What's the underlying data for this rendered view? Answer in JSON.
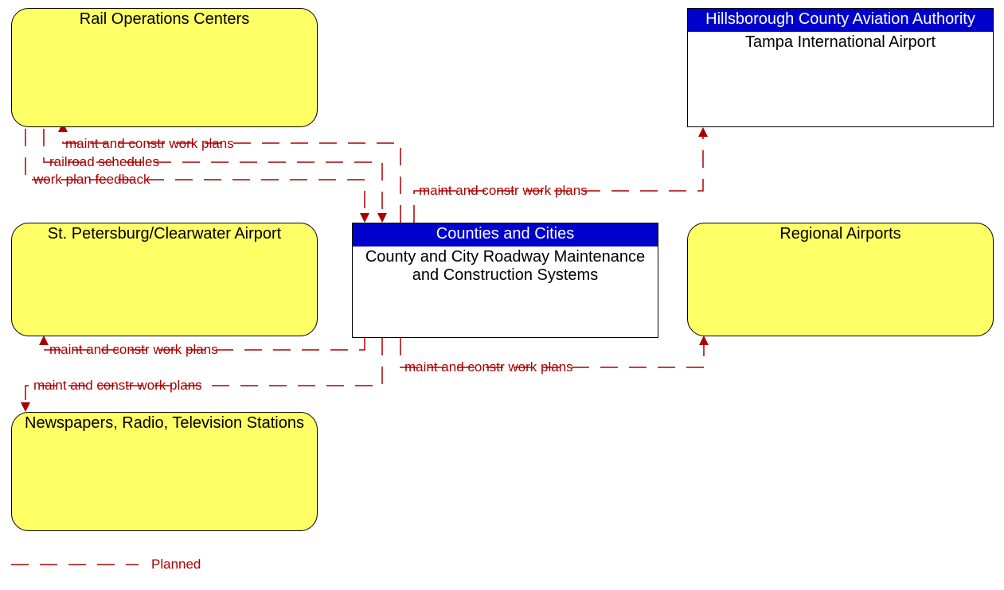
{
  "chart_data": {
    "type": "diagram",
    "nodes": [
      {
        "id": "rail",
        "title": "Rail Operations Centers",
        "header": null,
        "shape": "rounded",
        "fill": "#ffff66"
      },
      {
        "id": "tia",
        "title": "Tampa International Airport",
        "header": "Hillsborough County Aviation Authority",
        "shape": "rect",
        "fill": "#ffffff"
      },
      {
        "id": "spc",
        "title": "St. Petersburg/Clearwater Airport",
        "header": null,
        "shape": "rounded",
        "fill": "#ffff66"
      },
      {
        "id": "center",
        "title": "County and City Roadway Maintenance and Construction Systems",
        "header": "Counties and Cities",
        "shape": "rect",
        "fill": "#ffffff"
      },
      {
        "id": "regair",
        "title": "Regional Airports",
        "header": null,
        "shape": "rounded",
        "fill": "#ffff66"
      },
      {
        "id": "news",
        "title": "Newspapers, Radio, Television Stations",
        "header": null,
        "shape": "rounded",
        "fill": "#ffff66"
      }
    ],
    "flows": [
      {
        "from": "center",
        "to": "rail",
        "label": "maint and constr work plans",
        "style": "planned"
      },
      {
        "from": "rail",
        "to": "center",
        "label": "railroad schedules",
        "style": "planned"
      },
      {
        "from": "rail",
        "to": "center",
        "label": "work plan feedback",
        "style": "planned"
      },
      {
        "from": "center",
        "to": "tia",
        "label": "maint and constr work plans",
        "style": "planned"
      },
      {
        "from": "center",
        "to": "spc",
        "label": "maint and constr work plans",
        "style": "planned"
      },
      {
        "from": "center",
        "to": "regair",
        "label": "maint and constr work plans",
        "style": "planned"
      },
      {
        "from": "center",
        "to": "news",
        "label": "maint and constr work plans",
        "style": "planned"
      }
    ],
    "legend": {
      "style": "planned",
      "label": "Planned"
    }
  },
  "nodes": {
    "rail": {
      "title": "Rail Operations Centers"
    },
    "tia": {
      "header": "Hillsborough County Aviation Authority",
      "title": "Tampa International Airport"
    },
    "spc": {
      "title": "St. Petersburg/Clearwater Airport"
    },
    "center": {
      "header": "Counties and Cities",
      "title": "County and City Roadway Maintenance and Construction Systems"
    },
    "regair": {
      "title": "Regional Airports"
    },
    "news": {
      "title": "Newspapers, Radio, Television Stations"
    }
  },
  "labels": {
    "rail_plans": "maint and constr work plans",
    "rail_sched": "railroad schedules",
    "rail_fb": "work plan feedback",
    "tia_plans": "maint and constr work plans",
    "spc_plans": "maint and constr work plans",
    "regair_plans": "maint and constr work plans",
    "news_plans": "maint and constr work plans"
  },
  "legend": {
    "label": "Planned"
  }
}
